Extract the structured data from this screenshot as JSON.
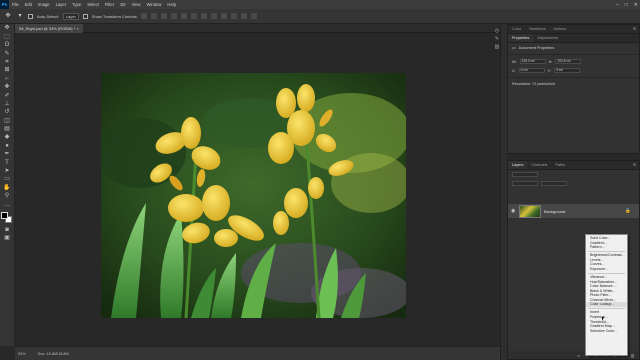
{
  "menubar": {
    "logo": "Ps",
    "items": [
      "File",
      "Edit",
      "Image",
      "Layer",
      "Type",
      "Select",
      "Filter",
      "3D",
      "View",
      "Window",
      "Help"
    ],
    "window_controls": [
      "–",
      "□",
      "✕"
    ]
  },
  "options_bar": {
    "auto_select_label": "Auto-Select:",
    "layer_select_value": "Layer",
    "transform_label": "Show Transform Controls"
  },
  "document_tab": {
    "title": "IM_Right.psd @ 33% (RGB/8) *",
    "close_glyph": "×"
  },
  "status_bar": {
    "zoom": "33%",
    "doc_size": "Doc: 18.8M/18.8M"
  },
  "properties_panel": {
    "tabs": [
      "Color",
      "Swatches",
      "Properties",
      "Adjustments",
      "Actions"
    ],
    "active_tab": "Properties",
    "section_title": "Document Properties",
    "fields": [
      {
        "label": "W:",
        "value": "126.9 cm"
      },
      {
        "label": "H:",
        "value": "102.8 cm"
      },
      {
        "label": "X:",
        "value": "0 cm"
      },
      {
        "label": "Y:",
        "value": "0 cm"
      }
    ],
    "resolution_label": "Resolution: 72 pixels/inch"
  },
  "layers_panel": {
    "tabs": [
      "Layers",
      "Channels",
      "Paths"
    ],
    "active_tab": "Layers",
    "layers": [
      {
        "name": "Background",
        "locked": true,
        "visible": true
      }
    ]
  },
  "adjustment_menu": {
    "groups": [
      [
        "Solid Color...",
        "Gradient...",
        "Pattern..."
      ],
      [
        "Brightness/Contrast...",
        "Levels...",
        "Curves...",
        "Exposure..."
      ],
      [
        "Vibrance...",
        "Hue/Saturation...",
        "Color Balance...",
        "Black & White...",
        "Photo Filter...",
        "Channel Mixer...",
        "Color Lookup..."
      ],
      [
        "Invert",
        "Posterize...",
        "Threshold...",
        "Gradient Map...",
        "Selective Color..."
      ]
    ],
    "highlighted": "Color Lookup..."
  },
  "colors": {
    "app_bg": "#282828",
    "panel_bg": "#323232",
    "menu_bg": "#f0f0f0",
    "accent": "#31a8ff"
  }
}
